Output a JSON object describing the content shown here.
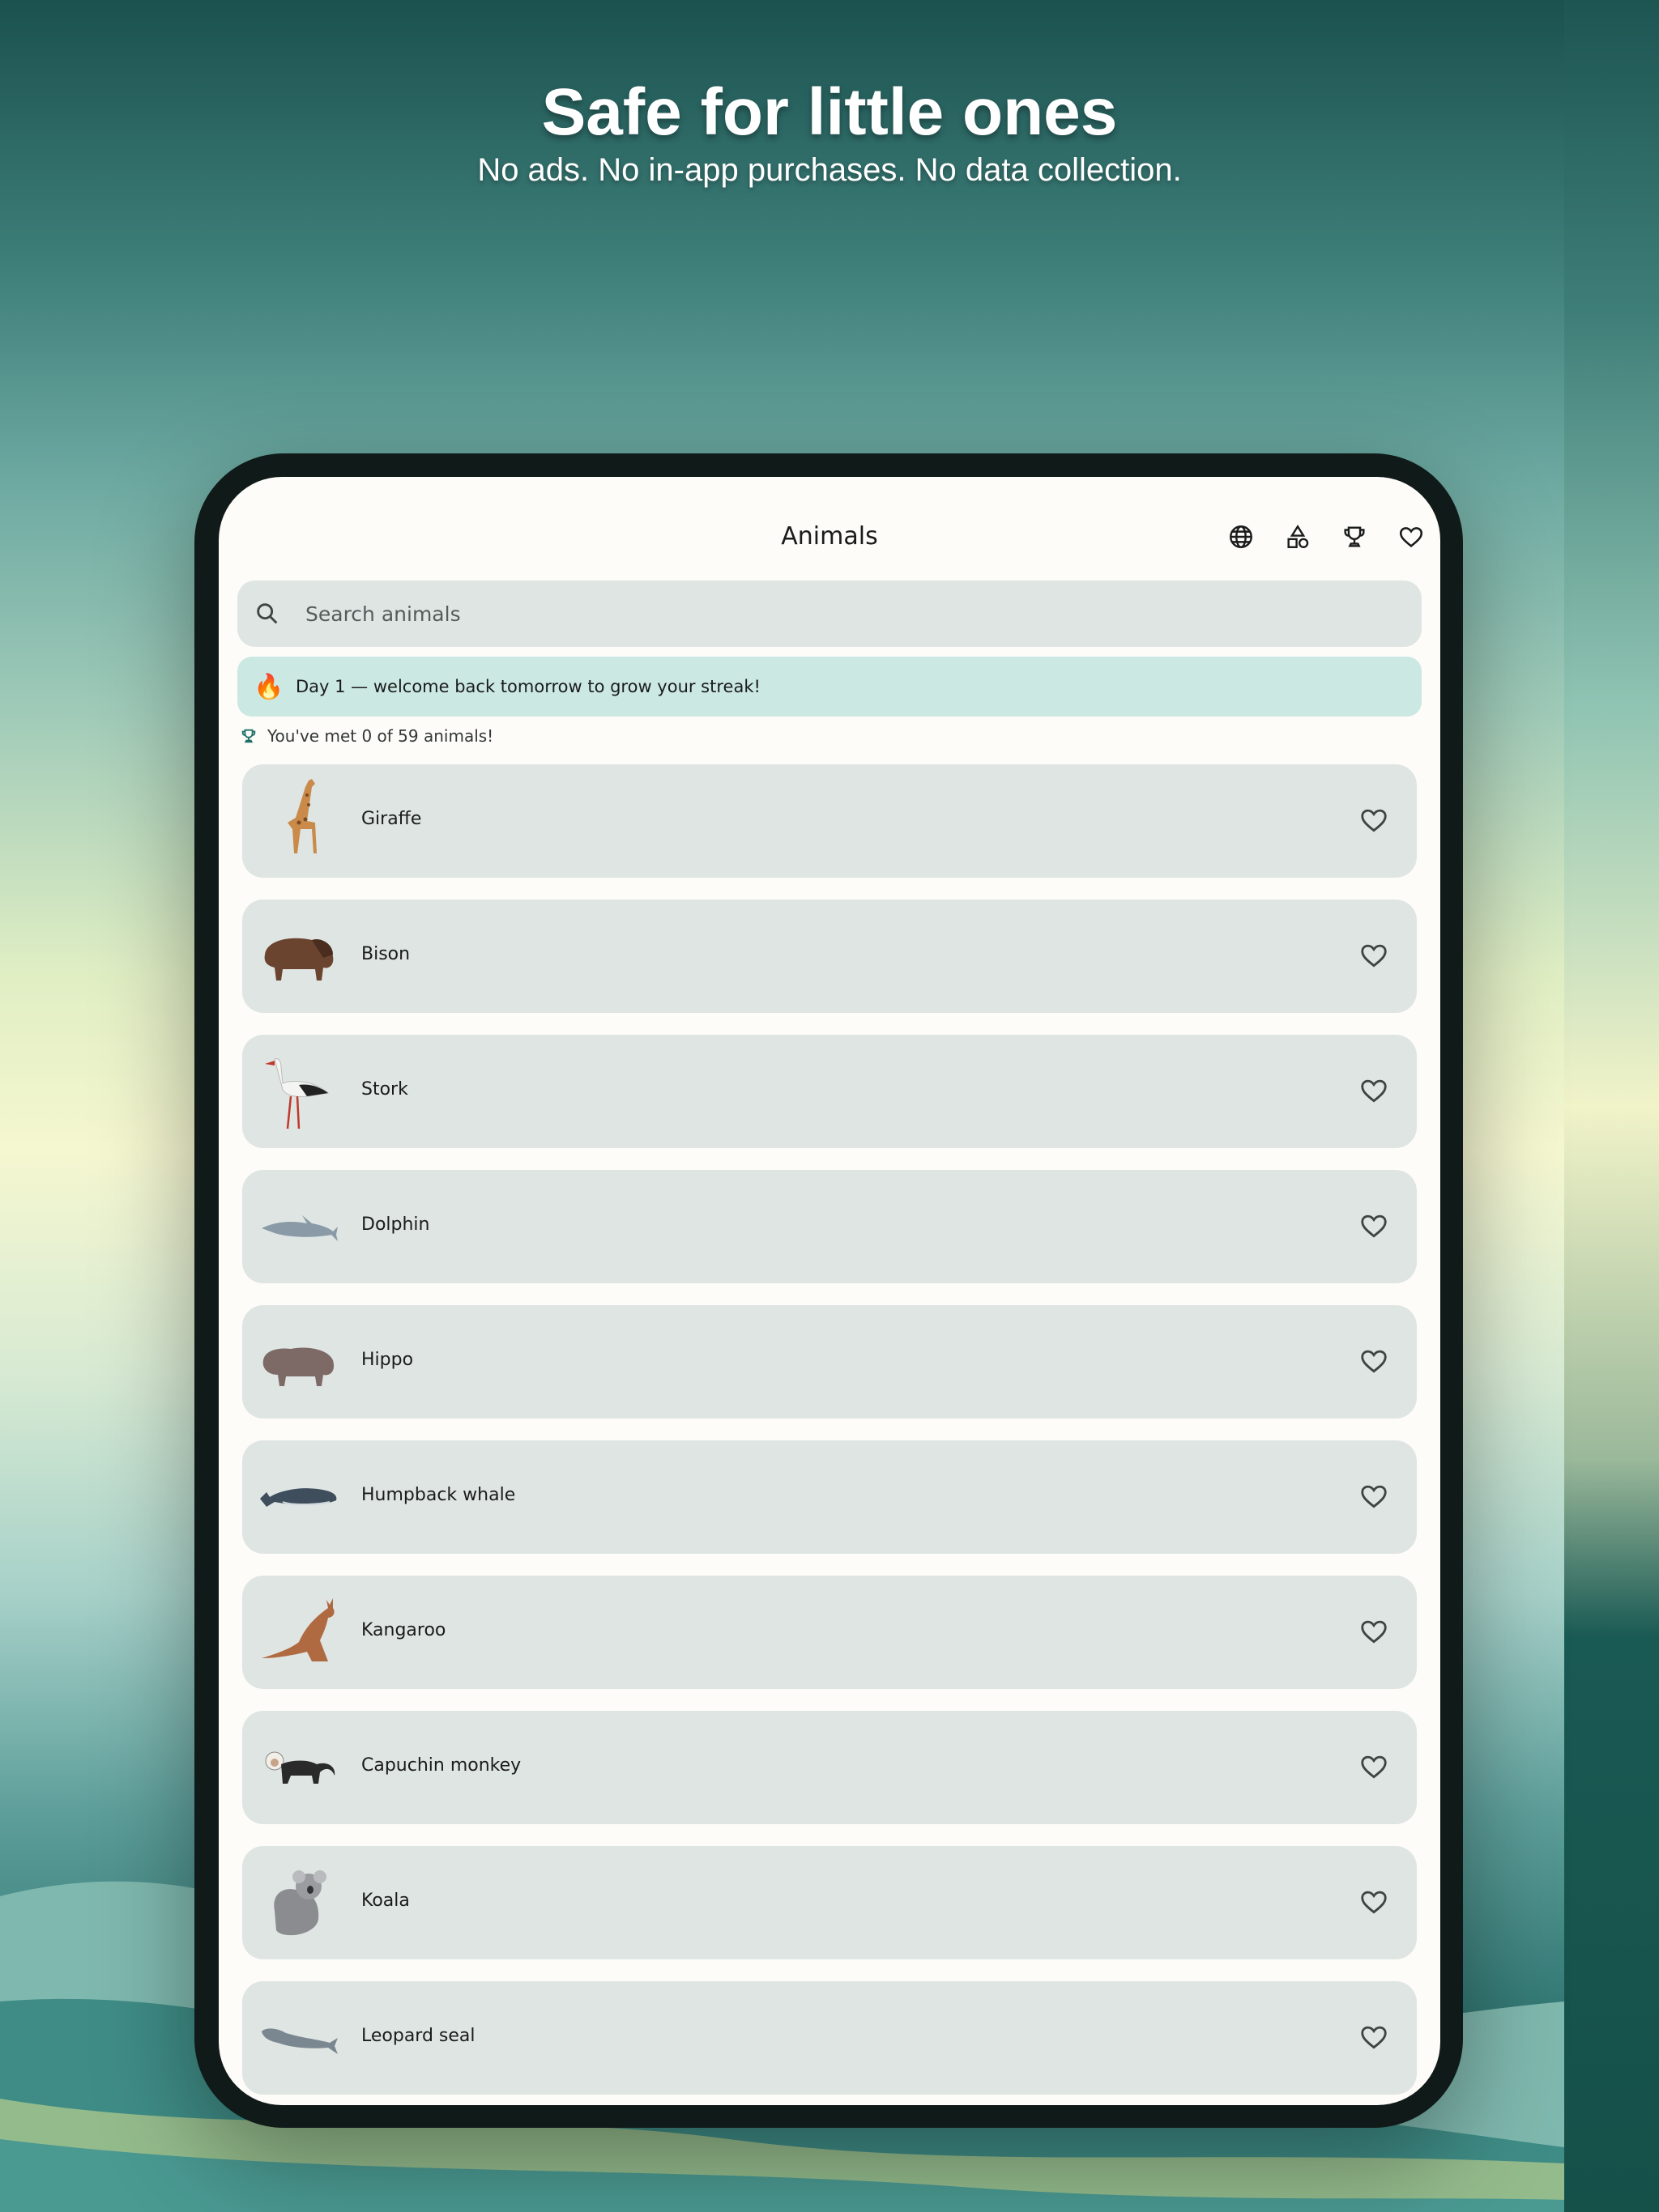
{
  "promo": {
    "title": "Safe for little ones",
    "subtitle": "No ads. No in-app purchases. No data collection."
  },
  "app": {
    "title": "Animals",
    "actions": [
      "globe-icon",
      "shapes-icon",
      "trophy-icon",
      "heart-icon"
    ]
  },
  "search": {
    "placeholder": "Search animals"
  },
  "streak": {
    "icon": "fire-icon",
    "text": "Day 1 — welcome back tomorrow to grow your streak!"
  },
  "progress": {
    "text": "You've met 0 of 59 animals!",
    "met": 0,
    "total": 59
  },
  "animals": [
    {
      "name": "Giraffe",
      "favorite": false
    },
    {
      "name": "Bison",
      "favorite": false
    },
    {
      "name": "Stork",
      "favorite": false
    },
    {
      "name": "Dolphin",
      "favorite": false
    },
    {
      "name": "Hippo",
      "favorite": false
    },
    {
      "name": "Humpback whale",
      "favorite": false
    },
    {
      "name": "Kangaroo",
      "favorite": false
    },
    {
      "name": "Capuchin monkey",
      "favorite": false
    },
    {
      "name": "Koala",
      "favorite": false
    },
    {
      "name": "Leopard seal",
      "favorite": false
    }
  ],
  "colors": {
    "card": "#dfe5e3",
    "streak_banner": "#cbe8e3",
    "screen": "#fdfcf8",
    "accent": "#1d6e66"
  }
}
